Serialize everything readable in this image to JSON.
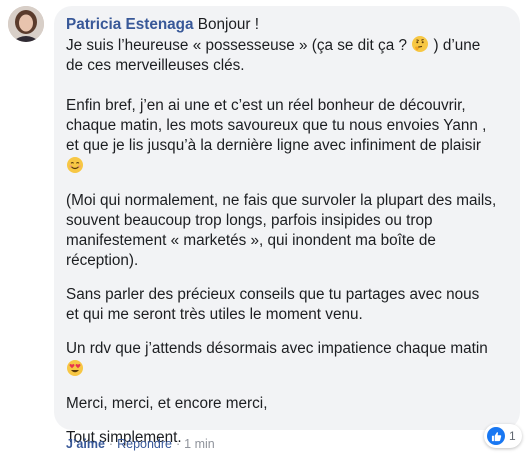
{
  "comment": {
    "author": "Patricia Estenaga",
    "paragraphs": [
      [
        "Bonjour !",
        "Je suis l’heureuse « possesseuse » (ça se dit ça ? ",
        " ) d’une",
        "de ces merveilleuses clés."
      ],
      [
        "Enfin bref, j’en ai une et c’est un réel bonheur de découvrir,",
        "chaque matin, les mots savoureux que tu nous envoies Yann ,",
        "et que je lis jusqu’à la dernière ligne avec infiniment de plaisir"
      ],
      [
        "(Moi qui normalement, ne fais que survoler la plupart des mails,",
        "souvent beaucoup trop longs, parfois insipides ou trop",
        "manifestement « marketés », qui inondent ma boîte de",
        "réception)."
      ],
      [
        "Sans parler des précieux conseils que tu partages avec nous",
        "et qui me seront très utiles le moment venu."
      ],
      [
        "Un rdv que j’attends désormais avec impatience chaque matin"
      ],
      [
        "Merci, merci, et encore merci,"
      ],
      [
        "Tout simplement."
      ]
    ],
    "emojis": [
      "thinking-face",
      "smiling-face",
      "heart-eyes-face"
    ]
  },
  "actions": {
    "like": "J’aime",
    "reply": "Répondre",
    "time": "1 min",
    "separator": "·"
  },
  "reactions": {
    "type": "like",
    "count": "1",
    "color": "#1877f2"
  },
  "colors": {
    "author": "#385898",
    "bubble": "#f2f3f5",
    "meta": "#90949c"
  }
}
